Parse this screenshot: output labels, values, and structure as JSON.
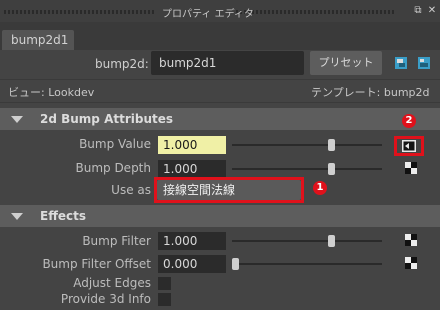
{
  "window": {
    "title": "プロパティ エディタ"
  },
  "tabs": [
    {
      "label": "bump2d1"
    }
  ],
  "node": {
    "type_label": "bump2d:",
    "name": "bump2d1",
    "preset_button": "プリセット"
  },
  "view": {
    "label": "ビュー: Lookdev",
    "template_label": "テンプレート: bump2d"
  },
  "sections": {
    "bump_attributes": {
      "title": "2d Bump Attributes",
      "bump_value": {
        "label": "Bump Value",
        "value": "1.000",
        "slider": 0.67
      },
      "bump_depth": {
        "label": "Bump Depth",
        "value": "1.000",
        "slider": 0.67
      },
      "use_as": {
        "label": "Use as",
        "value": "接線空間法線"
      }
    },
    "effects": {
      "title": "Effects",
      "bump_filter": {
        "label": "Bump Filter",
        "value": "1.000",
        "slider": 0.67
      },
      "bump_filter_offset": {
        "label": "Bump Filter Offset",
        "value": "0.000",
        "slider": 0.0
      },
      "adjust_edges": {
        "label": "Adjust Edges",
        "checked": false
      },
      "provide_3d_info": {
        "label": "Provide 3d Info",
        "checked": false
      }
    }
  },
  "annotations": {
    "badge_1": "1",
    "badge_2": "2",
    "color": "#e0111b"
  }
}
